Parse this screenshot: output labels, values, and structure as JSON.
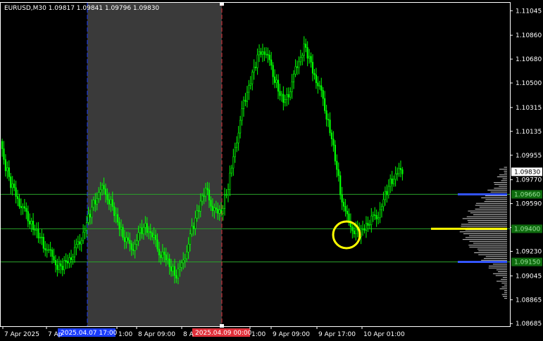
{
  "chart_title": "EURUSD,M30  1.09817 1.09841 1.09796 1.09830",
  "colors": {
    "background": "#000000",
    "candle": "#00ff00",
    "axis": "#ffffff",
    "selection": "#3a3a3a",
    "level_line": "#2aa02a",
    "level_box": "#0e6b0e",
    "profile": "#c8c8c8",
    "poc": "#ffff00",
    "value_area": "#3355ff",
    "start_marker": "#1a3cff",
    "end_marker": "#e0303a",
    "highlight_circle": "#ffff00"
  },
  "chart_data": {
    "type": "candlestick",
    "symbol": "EURUSD",
    "timeframe": "M30",
    "ohlc": {
      "open": "1.09817",
      "high": "1.09841",
      "low": "1.09796",
      "close": "1.09830"
    },
    "ylim": [
      1.08665,
      1.1111
    ],
    "price_ticks": [
      "1.11045",
      "1.10860",
      "1.10680",
      "1.10500",
      "1.10315",
      "1.10135",
      "1.09955",
      "1.09770",
      "1.09590",
      "1.09410",
      "1.09230",
      "1.09045",
      "1.08865",
      "1.08685"
    ],
    "time_ticks": [
      "7 Apr 2025",
      "7 Ap",
      "1:00",
      "8 Apr 09:00",
      "8 A",
      "1:00",
      "9 Apr 09:00",
      "9 Apr 17:00",
      "10 Apr 01:00"
    ],
    "range_start_label": "2025.04.07 17:00",
    "range_end_label": "2025.04.09 00:00",
    "current_price": "1.09830",
    "levels": [
      {
        "label": "1.09660",
        "value": 1.0966,
        "role": "value-area-high"
      },
      {
        "label": "1.09400",
        "value": 1.094,
        "role": "point-of-control"
      },
      {
        "label": "1.09150",
        "value": 1.0915,
        "role": "value-area-low"
      }
    ],
    "close_path": [
      1.1006,
      1.099,
      1.0982,
      1.0972,
      1.0968,
      1.0962,
      1.0956,
      1.0952,
      1.0948,
      1.0943,
      1.0938,
      1.0934,
      1.093,
      1.0926,
      1.0922,
      1.0918,
      1.0914,
      1.091,
      1.0912,
      1.0915,
      1.0918,
      1.0922,
      1.0926,
      1.0932,
      1.0938,
      1.0945,
      1.0953,
      1.096,
      1.0966,
      1.097,
      1.0968,
      1.0964,
      1.0958,
      1.095,
      1.0944,
      1.0938,
      1.0932,
      1.0928,
      1.0925,
      1.093,
      1.0936,
      1.094,
      1.0942,
      1.0938,
      1.0934,
      1.0928,
      1.0922,
      1.092,
      1.0916,
      1.0912,
      1.0908,
      1.0905,
      1.091,
      1.0918,
      1.0926,
      1.0935,
      1.0945,
      1.0954,
      1.0962,
      1.0968,
      1.0966,
      1.0958,
      1.0954,
      1.095,
      1.0955,
      1.0964,
      1.0974,
      1.0988,
      1.1003,
      1.1018,
      1.103,
      1.104,
      1.105,
      1.1058,
      1.1066,
      1.1072,
      1.1076,
      1.1071,
      1.1064,
      1.1056,
      1.1048,
      1.104,
      1.1035,
      1.104,
      1.1048,
      1.1056,
      1.1064,
      1.1072,
      1.1078,
      1.107,
      1.1062,
      1.1055,
      1.1048,
      1.104,
      1.103,
      1.1018,
      1.1005,
      1.099,
      1.0974,
      1.096,
      1.095,
      1.0944,
      1.094,
      1.0938,
      1.0936,
      1.094,
      1.0944,
      1.0946,
      1.0948,
      1.095,
      1.0955,
      1.0962,
      1.097,
      1.0976,
      1.098,
      1.0982,
      1.0983
    ]
  },
  "price_x_at": "px"
}
